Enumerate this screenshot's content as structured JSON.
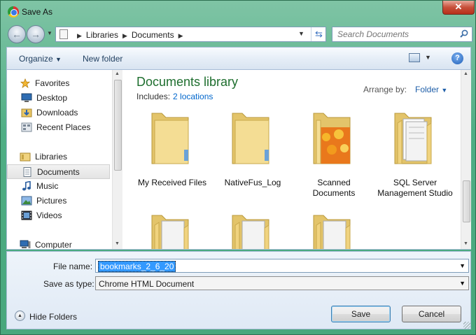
{
  "window": {
    "title": "Save As",
    "close_label": "✕"
  },
  "nav": {
    "breadcrumbs": [
      "Libraries",
      "Documents"
    ],
    "search_placeholder": "Search Documents"
  },
  "toolbar": {
    "organize": "Organize",
    "new_folder": "New folder"
  },
  "sidebar": {
    "favorites": {
      "label": "Favorites",
      "items": [
        "Desktop",
        "Downloads",
        "Recent Places"
      ]
    },
    "libraries": {
      "label": "Libraries",
      "items": [
        "Documents",
        "Music",
        "Pictures",
        "Videos"
      ]
    },
    "computer": "Computer",
    "selected": "Documents"
  },
  "library": {
    "title": "Documents library",
    "includes_label": "Includes:",
    "includes_link": "2 locations",
    "arrange_label": "Arrange by:",
    "arrange_value": "Folder"
  },
  "files": [
    {
      "name": "My Received Files",
      "thumb": "folder"
    },
    {
      "name": "NativeFus_Log",
      "thumb": "folder"
    },
    {
      "name": "Scanned Documents",
      "thumb": "folder-photo"
    },
    {
      "name": "SQL Server Management Studio",
      "thumb": "folder-docs"
    },
    {
      "name": "",
      "thumb": "folder-docs"
    },
    {
      "name": "",
      "thumb": "folder-docs"
    },
    {
      "name": "",
      "thumb": "folder-docs"
    }
  ],
  "form": {
    "file_name_label": "File name:",
    "file_name_value": "bookmarks_2_6_20",
    "save_type_label": "Save as type:",
    "save_type_value": "Chrome HTML Document"
  },
  "buttons": {
    "hide_folders": "Hide Folders",
    "save": "Save",
    "cancel": "Cancel"
  },
  "colors": {
    "accent_title": "#1e6e2e",
    "link": "#0066cc",
    "selection": "#3399ff",
    "frame": "#4fae85"
  }
}
